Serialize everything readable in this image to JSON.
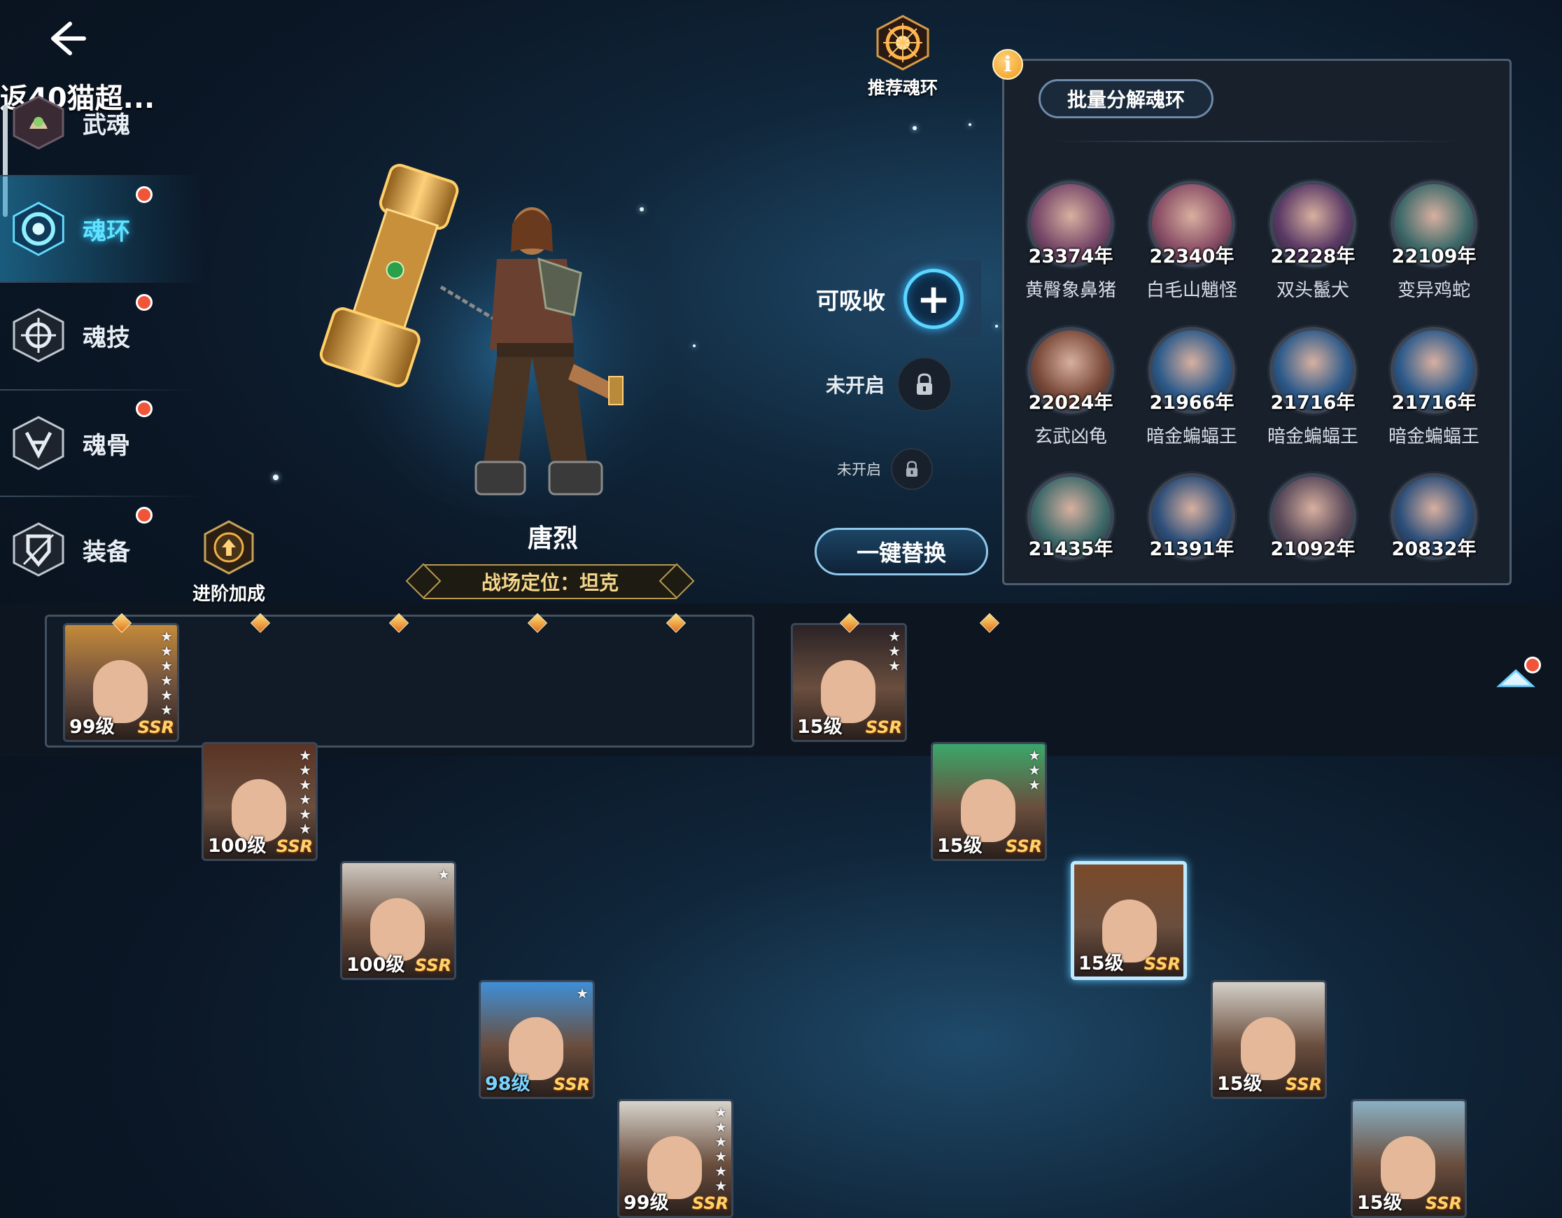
{
  "header": {
    "truncated_title": "返40猫超..."
  },
  "menu": [
    {
      "label": "武魂",
      "icon": "martial-soul-icon",
      "dot": false,
      "active": false
    },
    {
      "label": "魂环",
      "icon": "soul-ring-icon",
      "dot": true,
      "active": true
    },
    {
      "label": "魂技",
      "icon": "soul-skill-icon",
      "dot": true,
      "active": false
    },
    {
      "label": "魂骨",
      "icon": "soul-bone-icon",
      "dot": true,
      "active": false
    },
    {
      "label": "装备",
      "icon": "equipment-icon",
      "dot": true,
      "active": false
    }
  ],
  "advance": {
    "label": "进阶加成"
  },
  "recommend": {
    "label": "推荐魂环"
  },
  "character": {
    "name": "唐烈",
    "role": "战场定位：坦克"
  },
  "slots": {
    "absorb_label": "可吸收",
    "plus": "+",
    "locked1": "未开启",
    "locked2": "未开启",
    "replace_label": "一键替换"
  },
  "panel": {
    "info": "i",
    "batch_label": "批量分解魂环",
    "rings": [
      {
        "year": "23374年",
        "name": "黄臀象鼻猪",
        "color": "#7a4a6a"
      },
      {
        "year": "22340年",
        "name": "白毛山魈怪",
        "color": "#8a4f66"
      },
      {
        "year": "22228年",
        "name": "双头鬣犬",
        "color": "#5b3b66"
      },
      {
        "year": "22109年",
        "name": "变异鸡蛇",
        "color": "#3f6a6a"
      },
      {
        "year": "22024年",
        "name": "玄武凶龟",
        "color": "#7a4a3a"
      },
      {
        "year": "21966年",
        "name": "暗金蝙蝠王",
        "color": "#2d5a8a"
      },
      {
        "year": "21716年",
        "name": "暗金蝙蝠王",
        "color": "#2d5a8a"
      },
      {
        "year": "21716年",
        "name": "暗金蝙蝠王",
        "color": "#2d5a8a"
      },
      {
        "year": "21435年",
        "name": "",
        "color": "#3f6a6a"
      },
      {
        "year": "21391年",
        "name": "",
        "color": "#2d4f7a"
      },
      {
        "year": "21092年",
        "name": "",
        "color": "#5a4a5a"
      },
      {
        "year": "20832年",
        "name": "",
        "color": "#2d4f7a"
      }
    ]
  },
  "team": [
    {
      "level": "99级",
      "rarity": "SSR",
      "stars": 6,
      "hair": "#c58a3a",
      "blue": false
    },
    {
      "level": "100级",
      "rarity": "SSR",
      "stars": 6,
      "hair": "#5a3424",
      "blue": false
    },
    {
      "level": "100级",
      "rarity": "SSR",
      "stars": 1,
      "hair": "#cfc8c0",
      "blue": false
    },
    {
      "level": "98级",
      "rarity": "SSR",
      "stars": 1,
      "hair": "#3e8fd6",
      "blue": true
    },
    {
      "level": "99级",
      "rarity": "SSR",
      "stars": 6,
      "hair": "#d8d4cc",
      "blue": false
    }
  ],
  "roster": [
    {
      "level": "15级",
      "rarity": "SSR",
      "stars": 3,
      "hair": "#2a2226",
      "selected": false,
      "gem": true
    },
    {
      "level": "15级",
      "rarity": "SSR",
      "stars": 3,
      "hair": "#3aa86a",
      "selected": false,
      "gem": true
    },
    {
      "level": "15级",
      "rarity": "SSR",
      "stars": 0,
      "hair": "#7a4a2a",
      "selected": true,
      "gem": false
    },
    {
      "level": "15级",
      "rarity": "SSR",
      "stars": 0,
      "hair": "#d4d0c8",
      "selected": false,
      "gem": false
    },
    {
      "level": "15级",
      "rarity": "SSR",
      "stars": 0,
      "hair": "#8ab0c4",
      "selected": false,
      "gem": false
    }
  ],
  "colors": {
    "accent": "#5fe3ff",
    "red_dot": "#f0553a",
    "ssr": "#ffd36b"
  }
}
